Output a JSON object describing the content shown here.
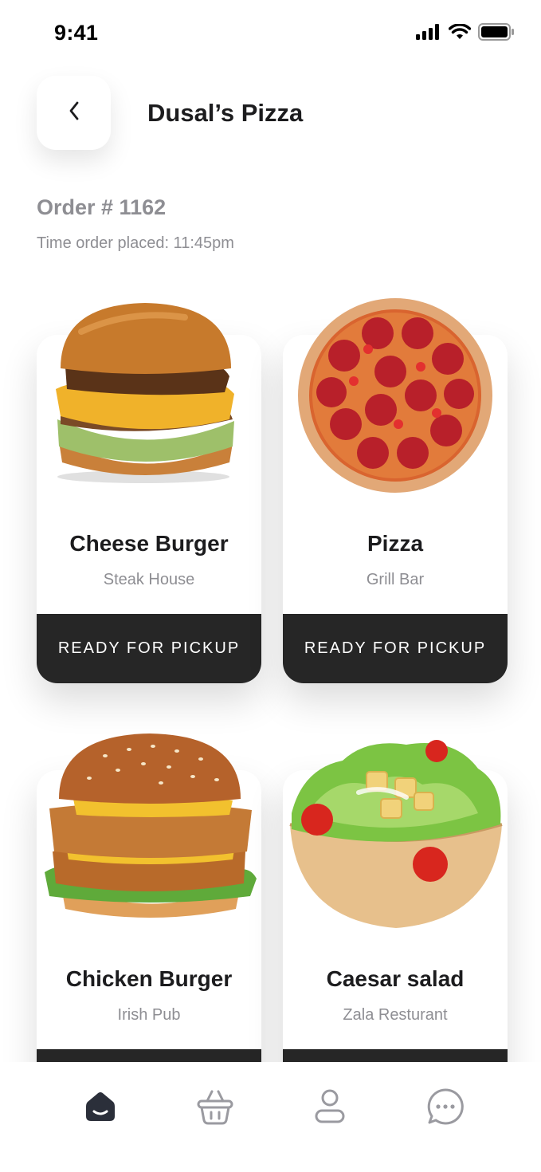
{
  "status_bar": {
    "time": "9:41",
    "icons": [
      "signal-icon",
      "wifi-icon",
      "battery-icon"
    ]
  },
  "header": {
    "back_icon": "chevron-left-icon",
    "title": "Dusal’s Pizza"
  },
  "order": {
    "number": "Order # 1162",
    "time_placed": "Time order placed: 11:45pm"
  },
  "items": [
    {
      "name": "Cheese Burger",
      "place": "Steak House",
      "status": "READY FOR PICKUP",
      "image": "cheese-burger-image"
    },
    {
      "name": "Pizza",
      "place": "Grill Bar",
      "status": "READY FOR PICKUP",
      "image": "pepperoni-pizza-image"
    },
    {
      "name": "Chicken Burger",
      "place": "Irish Pub",
      "status": "",
      "image": "chicken-burger-image"
    },
    {
      "name": "Caesar salad",
      "place": "Zala Resturant",
      "status": "",
      "image": "caesar-salad-image"
    }
  ],
  "bottom_nav": [
    {
      "icon": "home-icon",
      "active": true
    },
    {
      "icon": "basket-icon",
      "active": false
    },
    {
      "icon": "profile-icon",
      "active": false
    },
    {
      "icon": "chat-icon",
      "active": false
    }
  ],
  "colors": {
    "primary_dark": "#262626",
    "muted_text": "#8e8e93",
    "nav_inactive": "#9a9aa0",
    "nav_active": "#2b2f3a"
  }
}
